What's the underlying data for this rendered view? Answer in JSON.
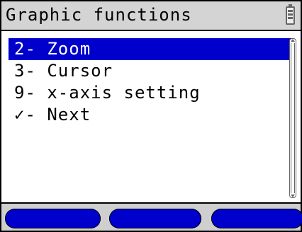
{
  "header": {
    "title": "Graphic functions",
    "battery_icon": "battery-icon"
  },
  "menu": {
    "items": [
      {
        "label": "2- Zoom",
        "selected": true
      },
      {
        "label": "3- Cursor",
        "selected": false
      },
      {
        "label": "9- x-axis setting",
        "selected": false
      },
      {
        "label": "✓- Next",
        "selected": false
      }
    ]
  },
  "softkeys": [
    {
      "label": ""
    },
    {
      "label": ""
    },
    {
      "label": ""
    }
  ],
  "colors": {
    "selection": "#0000cc",
    "title_bg": "#d4d4d4"
  }
}
